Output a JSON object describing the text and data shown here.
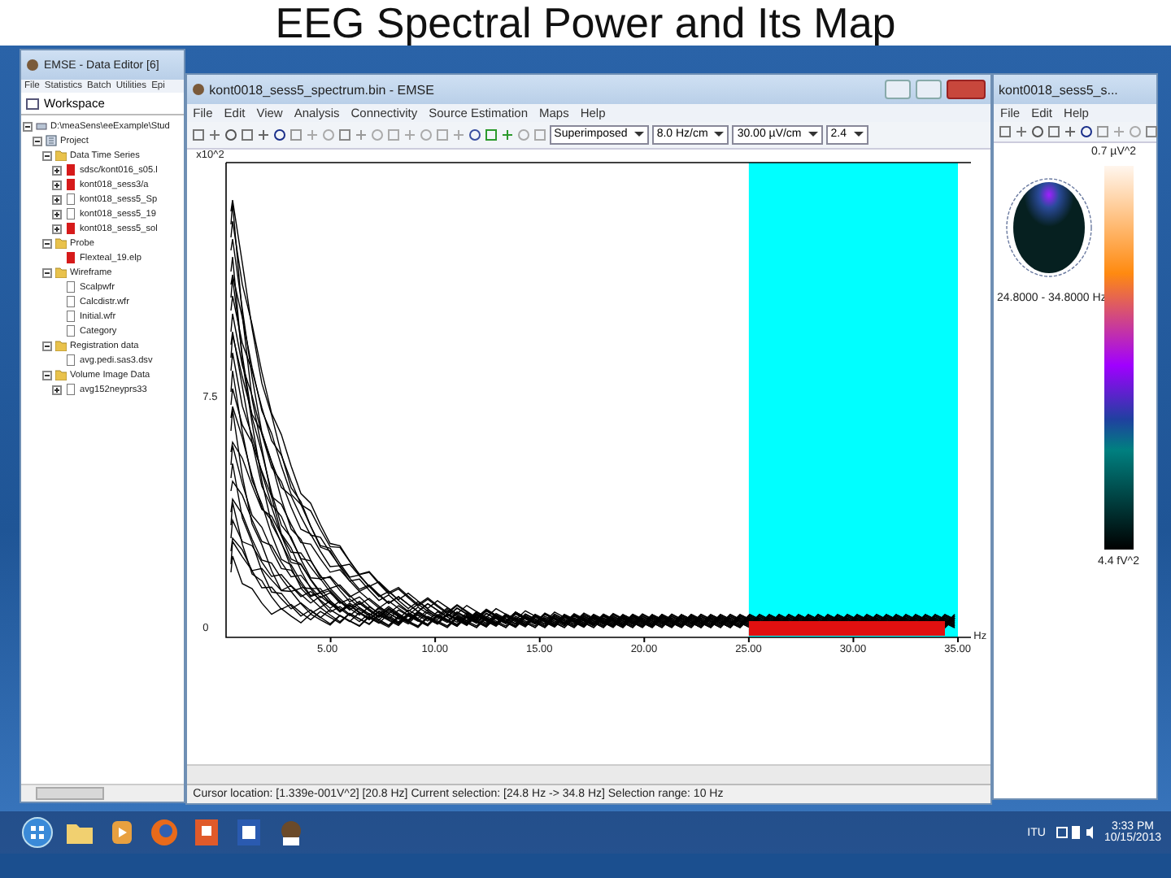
{
  "slide": {
    "title": "EEG Spectral Power and Its Map"
  },
  "data_editor": {
    "title": "EMSE - Data Editor [6]",
    "menu": [
      "File",
      "Statistics",
      "Batch",
      "Utilities",
      "Epi"
    ],
    "panel_tab": "Workspace",
    "tree": [
      {
        "label": "D:\\meaSens\\eeExample\\Stud",
        "kind": "root",
        "expanded": true,
        "children": [
          {
            "label": "Project",
            "kind": "project",
            "expanded": true,
            "children": [
              {
                "label": "Data Time Series",
                "kind": "folder",
                "expanded": true,
                "children": [
                  {
                    "label": "sdsc/kont016_s05.l",
                    "kind": "red-file",
                    "expanded": false
                  },
                  {
                    "label": "kont018_sess3/a",
                    "kind": "red-file",
                    "expanded": false
                  },
                  {
                    "label": "kont018_sess5_Sp",
                    "kind": "file",
                    "expanded": false
                  },
                  {
                    "label": "kont018_sess5_19",
                    "kind": "file",
                    "expanded": false
                  },
                  {
                    "label": "kont018_sess5_sol",
                    "kind": "red-file",
                    "expanded": false
                  }
                ]
              },
              {
                "label": "Probe",
                "kind": "folder",
                "expanded": true,
                "children": [
                  {
                    "label": "Flexteal_19.elp",
                    "kind": "red-file"
                  }
                ]
              },
              {
                "label": "Wireframe",
                "kind": "folder",
                "expanded": true,
                "children": [
                  {
                    "label": "Scalpwfr",
                    "kind": "file"
                  },
                  {
                    "label": "Calcdistr.wfr",
                    "kind": "file"
                  },
                  {
                    "label": "Initial.wfr",
                    "kind": "file"
                  },
                  {
                    "label": "Category",
                    "kind": "file"
                  }
                ]
              },
              {
                "label": "Registration data",
                "kind": "folder",
                "expanded": true,
                "children": [
                  {
                    "label": "avg.pedi.sas3.dsv",
                    "kind": "file"
                  }
                ]
              },
              {
                "label": "Volume Image Data",
                "kind": "folder",
                "expanded": true,
                "children": [
                  {
                    "label": "avg152neyprs33",
                    "kind": "file",
                    "expanded": false
                  }
                ]
              }
            ]
          }
        ]
      }
    ]
  },
  "spectrum_window": {
    "title": "kont0018_sess5_spectrum.bin - EMSE",
    "menu": [
      "File",
      "Edit",
      "View",
      "Analysis",
      "Connectivity",
      "Source Estimation",
      "Maps",
      "Help"
    ],
    "mode_select": "Superimposed",
    "x_scale_select": "8.0 Hz/cm",
    "y_scale_select": "30.00 µV/cm",
    "step_select": "2.4",
    "y_exponent": "x10^2",
    "y_labels": [
      "7.5",
      "0"
    ],
    "x_labels": [
      "5.00",
      "10.00",
      "15.00",
      "20.00",
      "25.00",
      "30.00",
      "35.00"
    ],
    "x_unit": "Hz",
    "status": "Cursor location: [1.339e-001V^2] [20.8 Hz] Current selection: [24.8 Hz -> 34.8 Hz] Selection range: 10 Hz"
  },
  "map_window": {
    "title": "kont0018_sess5_s...",
    "menu": [
      "File",
      "Edit",
      "Help"
    ],
    "max_label": "0.7 µV^2",
    "band_label": "24.8000 - 34.8000 Hz",
    "min_label": "4.4 fV^2"
  },
  "taskbar": {
    "tray_label": "ITU",
    "time": "3:33 PM",
    "date": "10/15/2013"
  }
}
